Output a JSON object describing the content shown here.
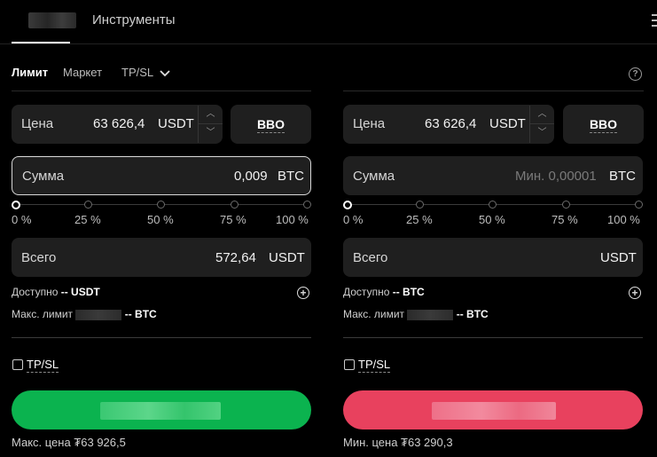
{
  "header": {
    "tab_instruments": "Инструменты"
  },
  "order_tabs": {
    "limit": "Лимит",
    "market": "Маркет",
    "tpsl": "TP/SL"
  },
  "buy": {
    "price_label": "Цена",
    "price_value": "63 626,4",
    "price_unit": "USDT",
    "bbo": "BBO",
    "amount_label": "Сумма",
    "amount_value": "0,009",
    "amount_unit": "BTC",
    "slider": [
      "0 %",
      "25 %",
      "50 %",
      "75 %",
      "100 %"
    ],
    "total_label": "Всего",
    "total_value": "572,64",
    "total_unit": "USDT",
    "available_label": "Доступно",
    "available_value": "-- USDT",
    "max_limit_label": "Макс. лимит",
    "max_limit_value": "-- BTC",
    "tpsl_label": "TP/SL",
    "price_info": "Макс. цена ₮63 926,5",
    "button_color": "#0bb34f"
  },
  "sell": {
    "price_label": "Цена",
    "price_value": "63 626,4",
    "price_unit": "USDT",
    "bbo": "BBO",
    "amount_label": "Сумма",
    "amount_placeholder": "Мин. 0,00001",
    "amount_unit": "BTC",
    "slider": [
      "0 %",
      "25 %",
      "50 %",
      "75 %",
      "100 %"
    ],
    "total_label": "Всего",
    "total_unit": "USDT",
    "available_label": "Доступно",
    "available_value": "-- BTC",
    "max_limit_label": "Макс. лимит",
    "max_limit_value": "-- BTC",
    "tpsl_label": "TP/SL",
    "price_info": "Мин. цена ₮63 290,3",
    "button_color": "#e8415e"
  }
}
